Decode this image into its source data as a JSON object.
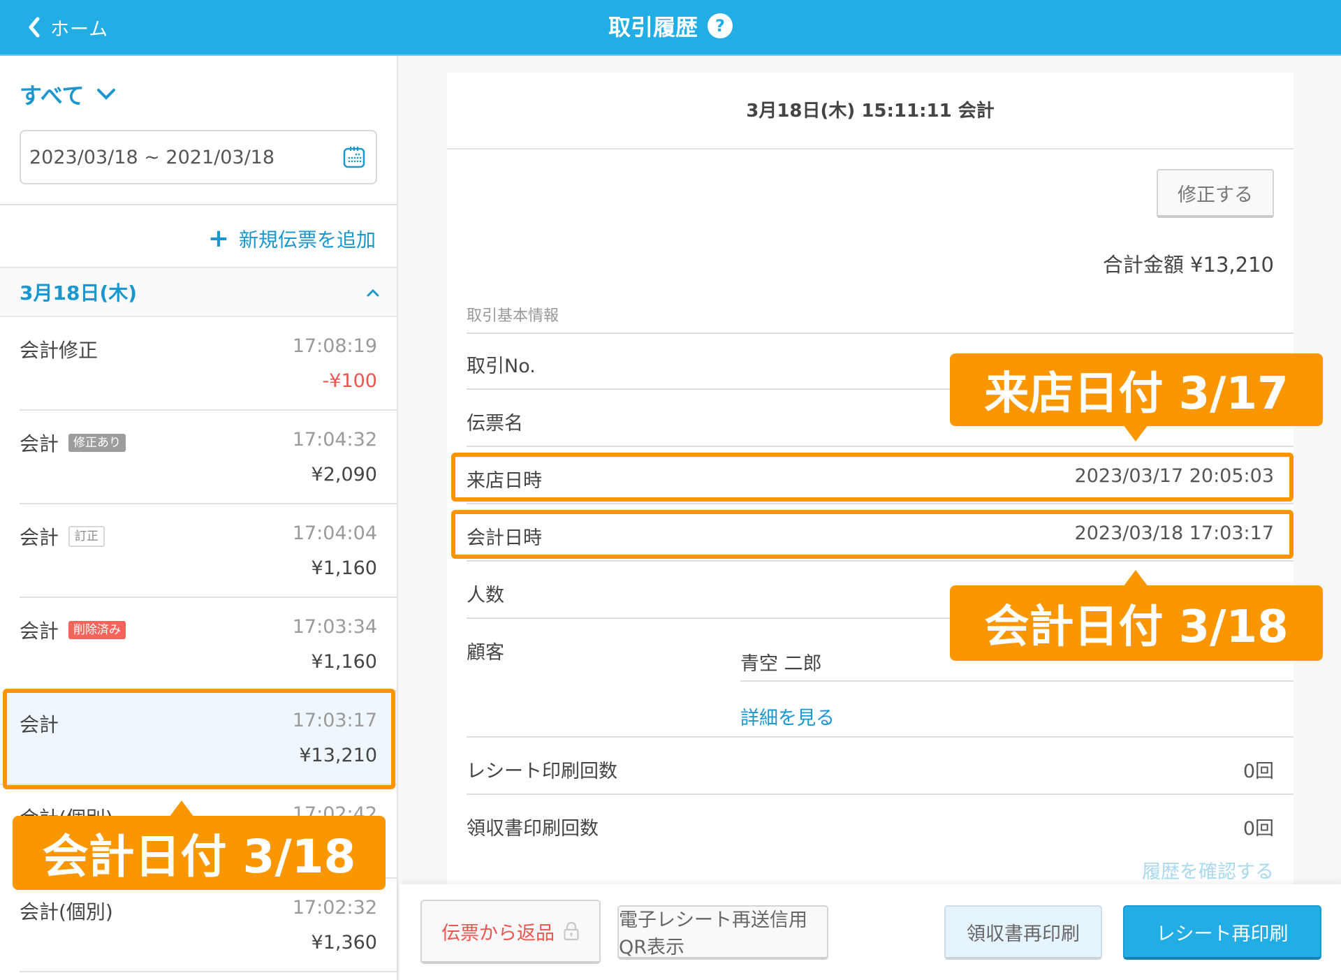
{
  "header": {
    "back_label": "ホーム",
    "title": "取引履歴",
    "help_glyph": "?"
  },
  "sidebar": {
    "filter_label": "すべて",
    "date_range": "2023/03/18 ~ 2021/03/18",
    "add_new_label": "新規伝票を追加",
    "day_header": "3月18日(木)",
    "transactions": [
      {
        "name": "会計修正",
        "badge": "",
        "time": "17:08:19",
        "amount": "-¥100"
      },
      {
        "name": "会計",
        "badge": "修正あり",
        "time": "17:04:32",
        "amount": "¥2,090"
      },
      {
        "name": "会計",
        "badge": "訂正",
        "time": "17:04:04",
        "amount": "¥1,160"
      },
      {
        "name": "会計",
        "badge": "削除済み",
        "time": "17:03:34",
        "amount": "¥1,160"
      },
      {
        "name": "会計",
        "badge": "",
        "time": "17:03:17",
        "amount": "¥13,210"
      },
      {
        "name": "会計(個別)",
        "badge": "",
        "time": "17:02:42",
        "amount": ""
      },
      {
        "name": "会計(個別)",
        "badge": "",
        "time": "17:02:32",
        "amount": "¥1,360"
      }
    ]
  },
  "detail": {
    "title": "3月18日(木) 15:11:11 会計",
    "edit_label": "修正する",
    "total": "合計金額 ¥13,210",
    "section_label": "取引基本情報",
    "rows": {
      "transaction_no": {
        "label": "取引No.",
        "value": ""
      },
      "slip_name": {
        "label": "伝票名",
        "value": ""
      },
      "visit_datetime": {
        "label": "来店日時",
        "value": "2023/03/17 20:05:03"
      },
      "checkout_datetime": {
        "label": "会計日時",
        "value": "2023/03/18 17:03:17"
      },
      "guests": {
        "label": "人数",
        "value": ""
      },
      "customer": {
        "label": "顧客",
        "value": "青空 二郎"
      },
      "receipt_prints": {
        "label": "レシート印刷回数",
        "value": "0回"
      },
      "invoice_prints": {
        "label": "領収書印刷回数",
        "value": "0回"
      }
    },
    "detail_link": "詳細を見る",
    "history_link": "履歴を確認する"
  },
  "actions": {
    "return_label": "伝票から返品",
    "qr_label": "電子レシート再送信用QR表示",
    "invoice_reprint_label": "領収書再印刷",
    "receipt_reprint_label": "レシート再印刷"
  },
  "annotations": {
    "visit_callout": "来店日付 3/17",
    "checkout_callout_right": "会計日付 3/18",
    "checkout_callout_left": "会計日付 3/18"
  },
  "colors": {
    "header": "#22aee4",
    "accent": "#1a97cf",
    "negative": "#f0544f",
    "annotation": "#fa9700"
  }
}
